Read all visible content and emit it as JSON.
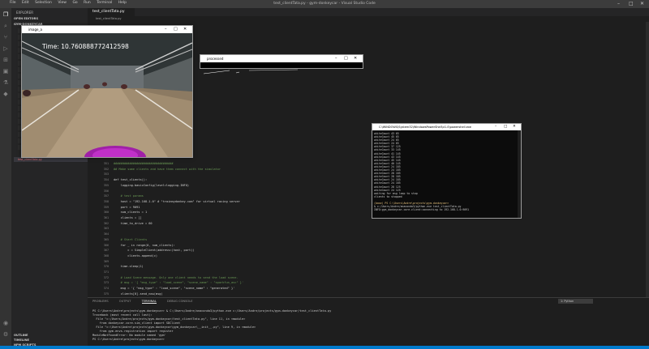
{
  "titlebar": {
    "menu": [
      "File",
      "Edit",
      "Selection",
      "View",
      "Go",
      "Run",
      "Terminal",
      "Help"
    ],
    "title": "test_clientTata.py - gym-donkeycar - Visual Studio Code"
  },
  "sidebar": {
    "header": "EXPLORER",
    "open_editors": "OPEN EDITORS",
    "project": "GYM-DONKEYCAR",
    "selected_file": "test_clientTata.py",
    "outline": "OUTLINE",
    "timeline": "TIMELINE",
    "npm_scripts": "NPM SCRIPTS"
  },
  "editor": {
    "tab_label": "test_clientTata.py",
    "breadcrumb": "test_clientTata.py",
    "lines": [
      {
        "n": "351",
        "text": "##################################"
      },
      {
        "n": "352",
        "text": "## Make some clients and have them connect with the simulator"
      },
      {
        "n": "353",
        "text": ""
      },
      {
        "n": "354",
        "text": "def test_clients():"
      },
      {
        "n": "355",
        "text": "    logging.basicConfig(level=logging.INFO)"
      },
      {
        "n": "356",
        "text": ""
      },
      {
        "n": "357",
        "text": "    # test params"
      },
      {
        "n": "358",
        "text": "    host = \"192.168.1.0\" # \"trainmydonkey.com\" for virtual racing server"
      },
      {
        "n": "359",
        "text": "    port = 9091"
      },
      {
        "n": "360",
        "text": "    num_clients = 1"
      },
      {
        "n": "361",
        "text": "    clients = []"
      },
      {
        "n": "362",
        "text": "    time_to_drive = 60"
      },
      {
        "n": "363",
        "text": ""
      },
      {
        "n": "364",
        "text": ""
      },
      {
        "n": "365",
        "text": "    # Start Clients"
      },
      {
        "n": "366",
        "text": "    for _ in range(0, num_clients):"
      },
      {
        "n": "367",
        "text": "        c = SimpleClient(address=(host, port))"
      },
      {
        "n": "368",
        "text": "        clients.append(c)"
      },
      {
        "n": "369",
        "text": ""
      },
      {
        "n": "370",
        "text": "    time.sleep(1)"
      },
      {
        "n": "371",
        "text": ""
      },
      {
        "n": "372",
        "text": "    # Load Scene message. Only one client needs to send the load scene."
      },
      {
        "n": "373",
        "text": "    # msg = '{ \"msg_type\" : \"load_scene\", \"scene_name\" : \"sparkfun_avc\" }'"
      },
      {
        "n": "374",
        "text": "    msg = '{ \"msg_type\" : \"load_scene\", \"scene_name\" : \"generated\" }'"
      },
      {
        "n": "375",
        "text": "    clients[0].send_now(msg)"
      }
    ]
  },
  "panel": {
    "tabs": [
      "PROBLEMS",
      "OUTPUT",
      "TERMINAL",
      "DEBUG CONSOLE"
    ],
    "active_tab": "TERMINAL",
    "terminal_select": "1: Python",
    "output_lines": [
      "PS C:\\Users\\Andre\\projects\\gym-donkeycar> & C:/Users/Andre/anaconda3/python.exe c:/Users/Andre/projects/gym-donkeycar/test_clientTata.py",
      "Traceback (most recent call last):",
      "  File \"c:/Users/Andre/projects/gym-donkeycar/test_clientTata.py\", line 11, in <module>",
      "    from donkeycar.core.sim_client import SDClient",
      "  File \"c:\\Users\\Andre\\projects\\gym-donkeycar\\gym_donkeycar\\__init__.py\", line 9, in <module>",
      "    from gym.envs.registration import register",
      "ModuleNotFoundError: No module named 'gym'",
      "PS C:\\Users\\Andre\\projects\\gym-donkeycar> "
    ]
  },
  "windows": {
    "image_a": {
      "title": "image_a",
      "time_text": "Time: 10.760888772412598"
    },
    "processed": {
      "title": "processed"
    },
    "terminal": {
      "title": "C:\\WINDOWS\\System32\\WindowsPowerShell\\v1.0\\powershell.exe",
      "lines": [
        "whiteCount 43 65",
        "whiteCount 45 65",
        "whiteCount 24 65",
        "whiteCount 24 65",
        "whiteCount 37 125",
        "whiteCount 33 145",
        "whiteCount 41 145",
        "whiteCount 43 145",
        "whiteCount 45 145",
        "whiteCount 40 145",
        "whiteCount 24 185",
        "whiteCount 24 185",
        "whiteCount 28 185",
        "whiteCount 28 185",
        "whiteCount 24 185",
        "whiteCount 24 185",
        "whiteCount 28 125",
        "whiteCount 24 125",
        "waiting for msg loop to stop",
        "clients to stopped",
        "",
        "(base) PS C:\\Users\\Andre\\projects\\gym-donkeycar>",
        "& c:/Users/Andre/anaconda3/python.exe test_clientTata.py",
        "INFO:gym_donkeycar.core.client:connecting to 192.168.1.0:9091"
      ]
    }
  },
  "colors": {
    "accent": "#007acc",
    "selection": "#37373d",
    "editor_bg": "#1e1e1e"
  }
}
